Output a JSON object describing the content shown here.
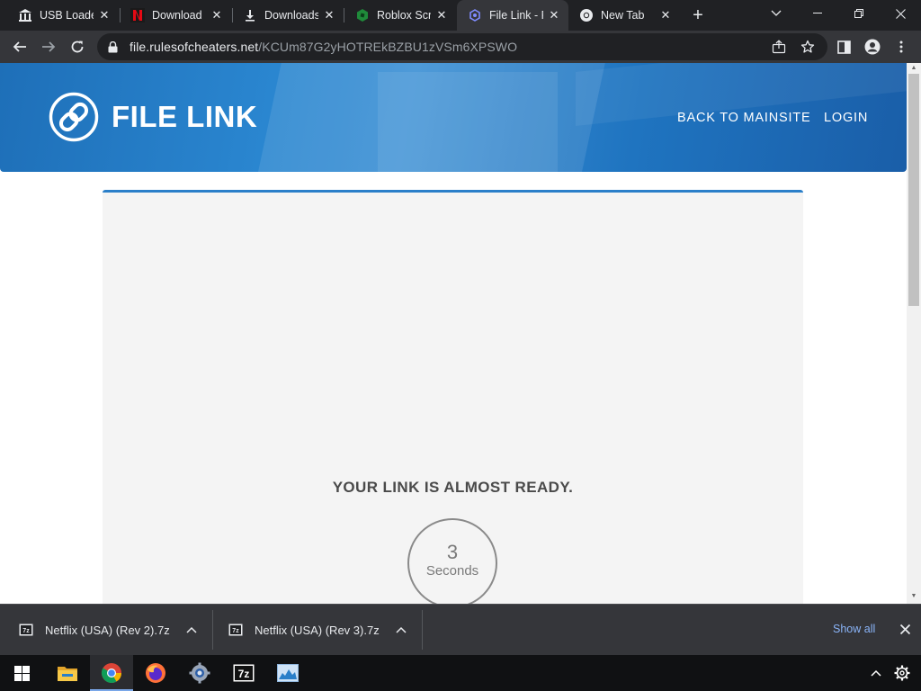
{
  "browser": {
    "tabs": [
      {
        "title": "USB Loader",
        "icon": "columns-icon"
      },
      {
        "title": "Download",
        "icon": "netflix-icon"
      },
      {
        "title": "Downloads",
        "icon": "download-icon"
      },
      {
        "title": "Roblox Scr",
        "icon": "roblox-icon"
      },
      {
        "title": "File Link - F",
        "icon": "file-link-icon",
        "active": true
      },
      {
        "title": "New Tab",
        "icon": "chrome-icon"
      }
    ],
    "address": {
      "domain": "file.rulesofcheaters.net",
      "path": "/KCUm87G2yHOTREkBZBU1zVSm6XPSWO"
    }
  },
  "page": {
    "brand": "FILE LINK",
    "nav": [
      "BACK TO MAINSITE",
      "LOGIN"
    ],
    "heading": "YOUR LINK IS ALMOST READY.",
    "countdown": {
      "value": "3",
      "unit": "Seconds"
    },
    "colors": {
      "hero": "#2a86d0",
      "accent": "#2a7fc9",
      "card": "#f4f4f4"
    }
  },
  "downloads": {
    "items": [
      {
        "name": "Netflix (USA) (Rev 2).7z",
        "icon": "7z-file-icon"
      },
      {
        "name": "Netflix (USA) (Rev 3).7z",
        "icon": "7z-file-icon"
      }
    ],
    "show_all": "Show all"
  },
  "taskbar": {
    "apps": [
      "windows-start-icon",
      "file-explorer-icon",
      "chrome-icon",
      "firefox-icon",
      "settings-app-icon",
      "7zip-icon",
      "photo-app-icon"
    ]
  }
}
